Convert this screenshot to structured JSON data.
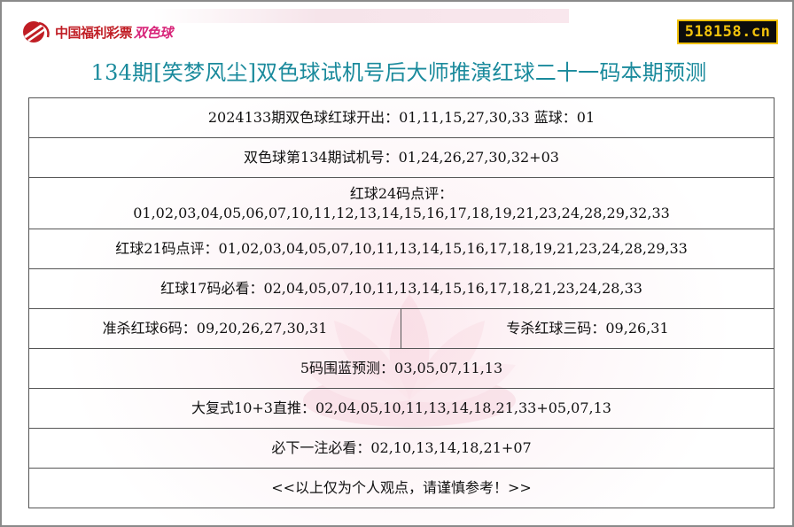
{
  "header": {
    "logo_text": "中国福利彩票",
    "logo_highlight": "双色球",
    "site_badge": "518158.cn",
    "brand_color": "#c01d24",
    "badge_bg": "#0c0c0c",
    "badge_fg": "#f2c20c"
  },
  "title": "134期[笑梦风尘]双色球试机号后大师推演红球二十一码本期预测",
  "rows": {
    "last_draw": "2024133期双色球红球开出：01,11,15,27,30,33 蓝球：01",
    "test_numbers": "双色球第134期试机号：01,24,26,27,30,32+03",
    "red24_label": "红球24码点评：",
    "red24_values": "01,02,03,04,05,06,07,10,11,12,13,14,15,16,17,18,19,21,23,24,28,29,32,33",
    "red21": "红球21码点评：01,02,03,04,05,07,10,11,13,14,15,16,17,18,19,21,23,24,28,29,33",
    "red17": "红球17码必看：02,04,05,07,10,11,13,14,15,16,17,18,21,23,24,28,33",
    "kill6": "准杀红球6码：09,20,26,27,30,31",
    "kill3": "专杀红球三码：09,26,31",
    "blue5": "5码围蓝预测：03,05,07,11,13",
    "big_combo": "大复式10+3直推：02,04,05,10,11,13,14,18,21,33+05,07,13",
    "must_pick": "必下一注必看：02,10,13,14,18,21+07",
    "disclaimer": "<<以上仅为个人观点，请谨慎参考！>>"
  },
  "title_color": "#1a8a9c",
  "icons": [
    "lottery-logo-icon",
    "lotus-watermark"
  ]
}
